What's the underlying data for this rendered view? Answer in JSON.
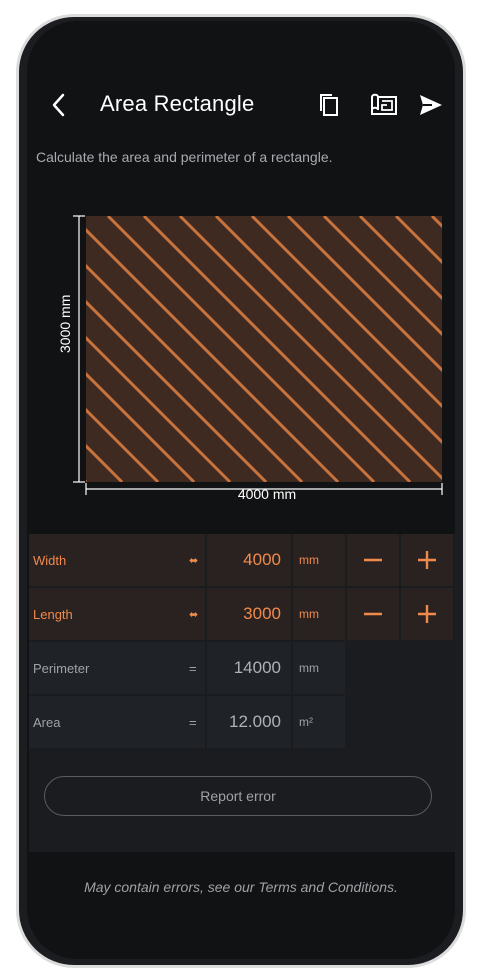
{
  "header": {
    "title": "Area Rectangle"
  },
  "description": "Calculate the area and perimeter of a rectangle.",
  "figure": {
    "width_label": "4000 mm",
    "height_label": "3000 mm",
    "fill_color": "#3f2a21",
    "hatch_color": "#c8733e"
  },
  "inputs": [
    {
      "label": "Width",
      "value": "4000",
      "unit": "mm",
      "swap_icon": "⬌"
    },
    {
      "label": "Length",
      "value": "3000",
      "unit": "mm",
      "swap_icon": "⬌"
    }
  ],
  "outputs": [
    {
      "label": "Perimeter",
      "sign": "=",
      "value": "14000",
      "unit": "mm"
    },
    {
      "label": "Area",
      "sign": "=",
      "value": "12.000",
      "unit": "m²"
    }
  ],
  "report_button": "Report error",
  "disclaimer": "May contain errors, see our Terms and Conditions.",
  "colors": {
    "accent": "#f08a4b",
    "background": "#111214",
    "panel": "#1a1c1f"
  }
}
